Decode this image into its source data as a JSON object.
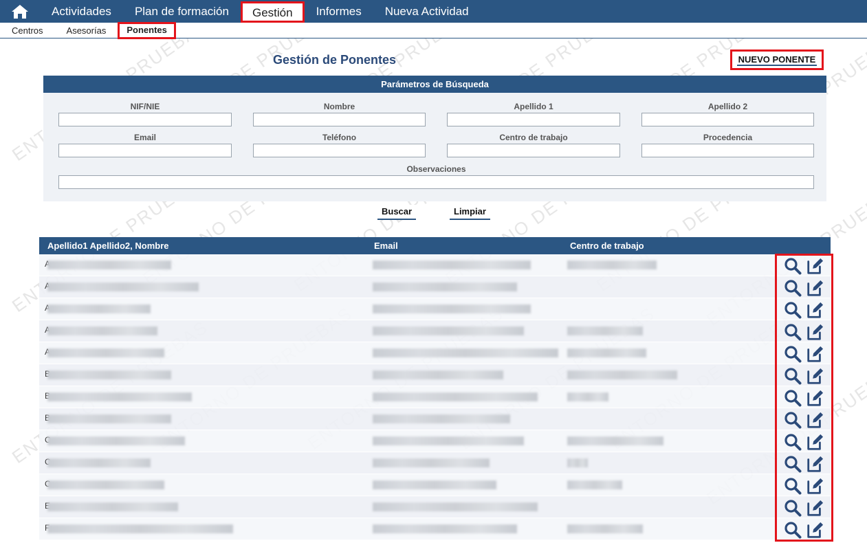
{
  "nav": {
    "items": [
      {
        "label": "Actividades",
        "active": false
      },
      {
        "label": "Plan de formación",
        "active": false
      },
      {
        "label": "Gestión",
        "active": true
      },
      {
        "label": "Informes",
        "active": false
      },
      {
        "label": "Nueva Actividad",
        "active": false
      }
    ]
  },
  "subnav": {
    "items": [
      {
        "label": "Centros",
        "active": false
      },
      {
        "label": "Asesorías",
        "active": false
      },
      {
        "label": "Ponentes",
        "active": true
      }
    ]
  },
  "page": {
    "title": "Gestión de Ponentes",
    "new_button": "NUEVO PONENTE"
  },
  "search": {
    "header": "Parámetros de Búsqueda",
    "fields": {
      "nif": {
        "label": "NIF/NIE",
        "value": ""
      },
      "nombre": {
        "label": "Nombre",
        "value": ""
      },
      "apellido1": {
        "label": "Apellido 1",
        "value": ""
      },
      "apellido2": {
        "label": "Apellido 2",
        "value": ""
      },
      "email": {
        "label": "Email",
        "value": ""
      },
      "telefono": {
        "label": "Teléfono",
        "value": ""
      },
      "centro": {
        "label": "Centro de trabajo",
        "value": ""
      },
      "procedencia": {
        "label": "Procedencia",
        "value": ""
      },
      "observaciones": {
        "label": "Observaciones",
        "value": ""
      }
    },
    "buttons": {
      "search": "Buscar",
      "clear": "Limpiar"
    }
  },
  "results": {
    "columns": [
      "Apellido1  Apellido2,  Nombre",
      "Email",
      "Centro de trabajo"
    ],
    "rows": [
      {
        "initial": "A"
      },
      {
        "initial": "A"
      },
      {
        "initial": "A"
      },
      {
        "initial": "A"
      },
      {
        "initial": "A"
      },
      {
        "initial": "B"
      },
      {
        "initial": "B"
      },
      {
        "initial": "B"
      },
      {
        "initial": "C"
      },
      {
        "initial": "C"
      },
      {
        "initial": "C"
      },
      {
        "initial": "E"
      },
      {
        "initial": "F"
      }
    ]
  },
  "watermark": "ENTORNO DE PRUEBAS",
  "colors": {
    "primary": "#2b5683",
    "highlight": "#e3141b",
    "panel": "#eff2f6"
  }
}
